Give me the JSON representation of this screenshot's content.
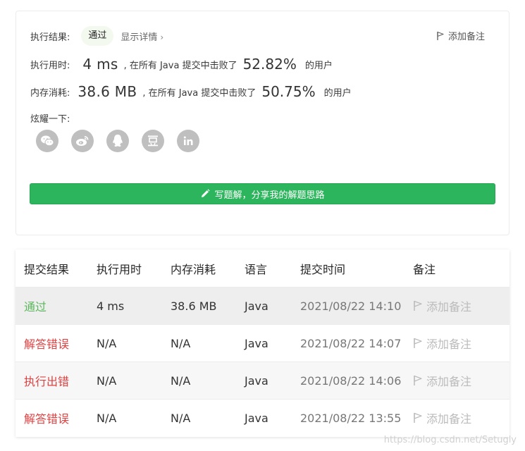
{
  "result": {
    "status_label": "执行结果:",
    "status_value": "通过",
    "details_link": "显示详情",
    "details_chevron": "›",
    "add_note": "添加备注"
  },
  "runtime": {
    "label": "执行用时:",
    "value": "4 ms",
    "mid_text": ", 在所有 Java 提交中击败了",
    "percent": "52.82%",
    "suffix": "的用户"
  },
  "memory": {
    "label": "内存消耗:",
    "value": "38.6 MB",
    "mid_text": ", 在所有 Java 提交中击败了",
    "percent": "50.75%",
    "suffix": "的用户"
  },
  "share": {
    "label": "炫耀一下:",
    "icons": [
      "wechat-icon",
      "weibo-icon",
      "qq-icon",
      "douban-icon",
      "linkedin-icon"
    ]
  },
  "solution_button": "写题解，分享我的解题思路",
  "table": {
    "headers": [
      "提交结果",
      "执行用时",
      "内存消耗",
      "语言",
      "提交时间",
      "备注"
    ],
    "rows": [
      {
        "result": "通过",
        "runtime": "4 ms",
        "memory": "38.6 MB",
        "lang": "Java",
        "time": "2021/08/22 14:10",
        "note": "添加备注"
      },
      {
        "result": "解答错误",
        "runtime": "N/A",
        "memory": "N/A",
        "lang": "Java",
        "time": "2021/08/22 14:07",
        "note": "添加备注"
      },
      {
        "result": "执行出错",
        "runtime": "N/A",
        "memory": "N/A",
        "lang": "Java",
        "time": "2021/08/22 14:06",
        "note": "添加备注"
      },
      {
        "result": "解答错误",
        "runtime": "N/A",
        "memory": "N/A",
        "lang": "Java",
        "time": "2021/08/22 13:55",
        "note": "添加备注"
      }
    ]
  },
  "watermark": "https://blog.csdn.net/Setugly",
  "colors": {
    "accepted": "#5cb85c",
    "error": "#e04141",
    "button": "#2db55d",
    "share_icon": "#bfbfbf"
  }
}
